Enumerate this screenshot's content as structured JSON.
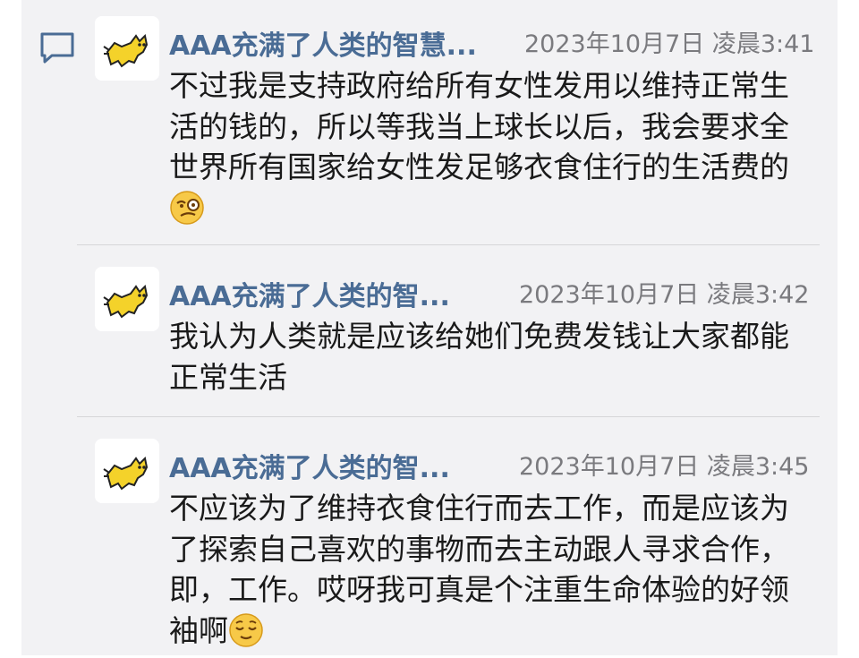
{
  "thread": {
    "messages": [
      {
        "name": "AAA充满了人类的智慧...",
        "time": "2023年10月7日 凌晨3:41",
        "text": "不过我是支持政府给所有女性发用以维持正常生活的钱的，所以等我当上球长以后，我会要求全世界所有国家给女性发足够衣食住行的生活费的",
        "emoji": "face-with-monocle-emoji"
      },
      {
        "name": "AAA充满了人类的智...",
        "time": "2023年10月7日 凌晨3:42",
        "text": "我认为人类就是应该给她们免费发钱让大家都能正常生活",
        "emoji": ""
      },
      {
        "name": "AAA充满了人类的智...",
        "time": "2023年10月7日 凌晨3:45",
        "text": "不应该为了维持衣食住行而去工作，而是应该为了探索自己喜欢的事物而去主动跟人寻求合作，即，工作。哎呀我可真是个注重生命体验的好领袖啊",
        "emoji": "relieved-face-emoji"
      }
    ]
  },
  "colors": {
    "name": "#4a6c95",
    "time": "#7a7a7e",
    "text": "#1a1a1a",
    "background": "#f2f2f4",
    "comment_icon": "#4a6c95"
  },
  "icons": {
    "comment": "comment-icon",
    "avatar": "yellow-cat-avatar"
  }
}
